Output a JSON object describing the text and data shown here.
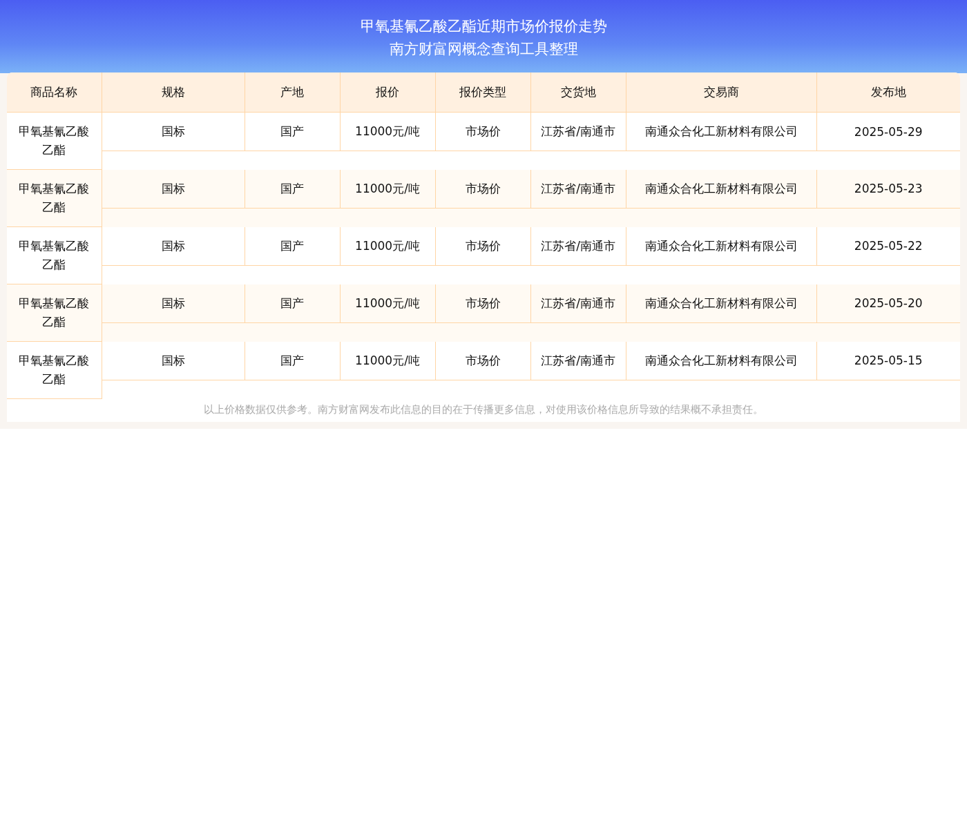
{
  "header": {
    "title": "甲氧基氰乙酸乙酯近期市场价报价走势",
    "subtitle": "南方财富网概念查询工具整理"
  },
  "table": {
    "columns": [
      "商品名称",
      "规格",
      "产地",
      "报价",
      "报价类型",
      "交货地",
      "交易商",
      "发布地"
    ],
    "rows": [
      {
        "cells": [
          "甲氧基氰乙酸乙酯",
          "国标",
          "国产",
          "11000元/吨",
          "市场价",
          "江苏省/南通市",
          "南通众合化工新材料有限公司",
          "2025-05-29"
        ]
      },
      {
        "cells": [
          "甲氧基氰乙酸乙酯",
          "国标",
          "国产",
          "11000元/吨",
          "市场价",
          "江苏省/南通市",
          "南通众合化工新材料有限公司",
          "2025-05-23"
        ]
      },
      {
        "cells": [
          "甲氧基氰乙酸乙酯",
          "国标",
          "国产",
          "11000元/吨",
          "市场价",
          "江苏省/南通市",
          "南通众合化工新材料有限公司",
          "2025-05-22"
        ]
      },
      {
        "cells": [
          "甲氧基氰乙酸乙酯",
          "国标",
          "国产",
          "11000元/吨",
          "市场价",
          "江苏省/南通市",
          "南通众合化工新材料有限公司",
          "2025-05-20"
        ]
      },
      {
        "cells": [
          "甲氧基氰乙酸乙酯",
          "国标",
          "国产",
          "11000元/吨",
          "市场价",
          "江苏省/南通市",
          "南通众合化工新材料有限公司",
          "2025-05-15"
        ]
      }
    ]
  },
  "footer_note": "以上价格数据仅供参考。南方财富网发布此信息的目的在于传播更多信息，对使用该价格信息所导致的结果概不承担责任。"
}
